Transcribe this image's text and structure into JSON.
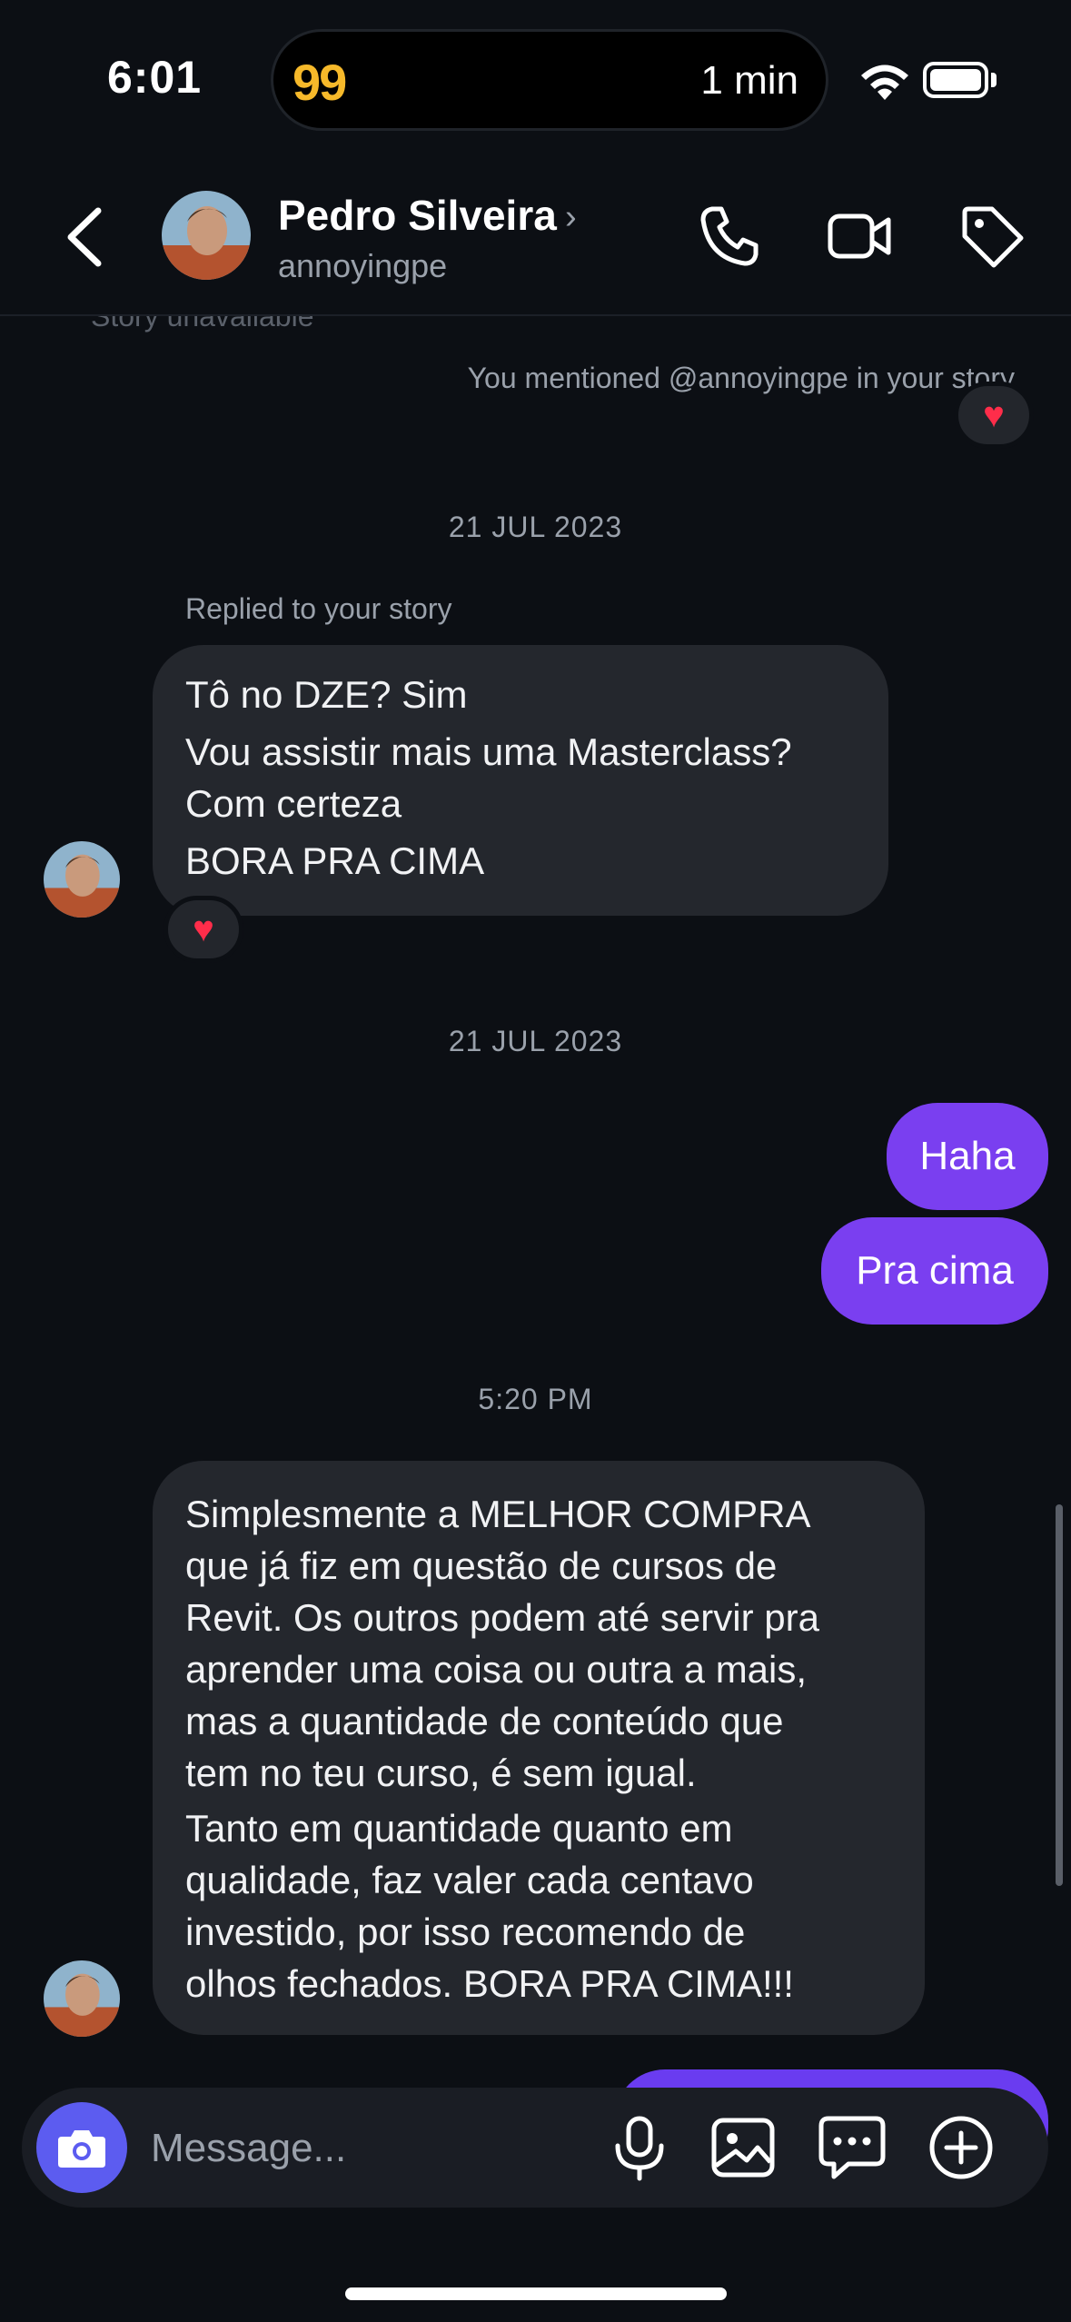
{
  "status": {
    "time": "6:01",
    "live_activity_app": "99",
    "live_activity_text": "1 min"
  },
  "header": {
    "contact_name": "Pedro Silveira",
    "contact_handle": "annoyingpe"
  },
  "story_stub_text": "Story unavailable",
  "mention_notice": "You mentioned @annoyingpe in your story",
  "dates": {
    "first": "21 JUL 2023",
    "second": "21 JUL 2023",
    "time_stamp": "5:20 PM"
  },
  "reply_label": "Replied to your story",
  "reply_message": {
    "lines": [
      "Tô no DZE? Sim",
      "Vou assistir mais uma Masterclass?",
      "Com certeza",
      "BORA PRA CIMA"
    ]
  },
  "outgoing": [
    "Haha",
    "Pra cima"
  ],
  "long_message": {
    "lines": [
      "Simplesmente a MELHOR COMPRA",
      "que já fiz em questão de cursos de",
      "Revit. Os outros podem até servir pra",
      "aprender uma coisa ou outra a mais,",
      "mas a quantidade de conteúdo que",
      "tem no teu curso, é sem igual.",
      "Tanto em quantidade quanto em",
      "qualidade, faz valer cada centavo",
      "investido, por isso recomendo de",
      "olhos fechados. BORA PRA CIMA!!!"
    ]
  },
  "composer": {
    "placeholder": "Message..."
  },
  "colors": {
    "outgoing_bubble": "#7a3ff0",
    "incoming_bubble": "#24272d",
    "camera_button": "#5c5cf0",
    "background": "#0c0f14"
  }
}
